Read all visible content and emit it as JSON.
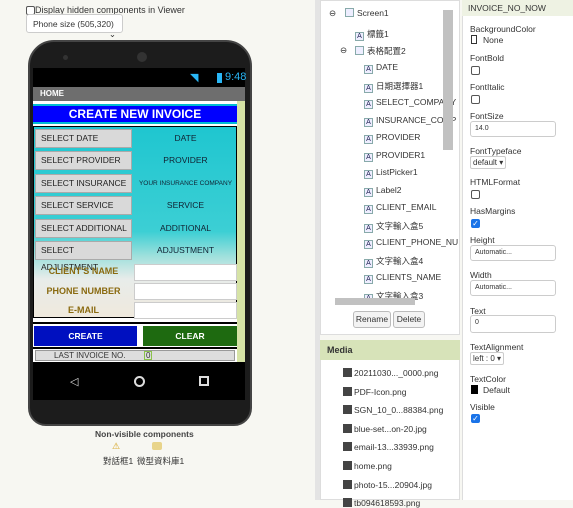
{
  "viewer": {
    "hidden_label": "Display hidden components in Viewer",
    "phone_size": "Phone size (505,320)",
    "nonvisible_title": "Non-visible components",
    "nonvisible": [
      "對話框1",
      "微型資料庫1"
    ]
  },
  "phone": {
    "time": "9:48",
    "home": "HOME",
    "title": "CREATE NEW INVOICE",
    "rows": [
      {
        "button": "SELECT DATE",
        "value": "DATE"
      },
      {
        "button": "SELECT PROVIDER",
        "value": "PROVIDER"
      },
      {
        "button": "SELECT INSURANCE",
        "value": "YOUR INSURANCE COMPANY"
      },
      {
        "button": "SELECT SERVICE",
        "value": "SERVICE"
      },
      {
        "button": "SELECT ADDITIONAL",
        "value": "ADDITIONAL"
      },
      {
        "button": "SELECT ADJUSTMENT",
        "value": "ADJUSTMENT"
      }
    ],
    "fields": [
      "CLIENT'S NAME",
      "PHONE NUMBER",
      "E-MAIL"
    ],
    "create": "CREATE",
    "clear": "CLEAR",
    "last_invoice_label": "LAST INVOICE NO.",
    "last_invoice_value": "0"
  },
  "tree": {
    "items": [
      "Screen1",
      "標籤1",
      "表格配置2",
      "DATE",
      "日期選擇器1",
      "SELECT_COMPANY",
      "INSURANCE_COMP",
      "PROVIDER",
      "PROVIDER1",
      "ListPicker1",
      "Label2",
      "CLIENT_EMAIL",
      "文字輸入盒5",
      "CLIENT_PHONE_NU",
      "文字輸入盒4",
      "CLIENTS_NAME",
      "文字輸入盒3"
    ],
    "rename": "Rename",
    "delete": "Delete"
  },
  "media": {
    "title": "Media",
    "items": [
      "20211030..._0000.png",
      "PDF-Icon.png",
      "SGN_10_0...88384.png",
      "blue-set...on-20.jpg",
      "email-13...33939.png",
      "home.png",
      "photo-15...20904.jpg",
      "tb094618593.png"
    ]
  },
  "properties": {
    "component": "INVOICE_NO_NOW",
    "BackgroundColor": "BackgroundColor",
    "bg_value": "None",
    "FontBold": "FontBold",
    "FontItalic": "FontItalic",
    "FontSize": "FontSize",
    "fontsize_value": "14.0",
    "FontTypeface": "FontTypeface",
    "typeface_value": "default",
    "HTMLFormat": "HTMLFormat",
    "HasMargins": "HasMargins",
    "Height": "Height",
    "height_value": "Automatic...",
    "Width": "Width",
    "width_value": "Automatic...",
    "Text": "Text",
    "text_value": "0",
    "TextAlignment": "TextAlignment",
    "align_value": "left : 0",
    "TextColor": "TextColor",
    "textcolor_value": "Default",
    "Visible": "Visible"
  }
}
